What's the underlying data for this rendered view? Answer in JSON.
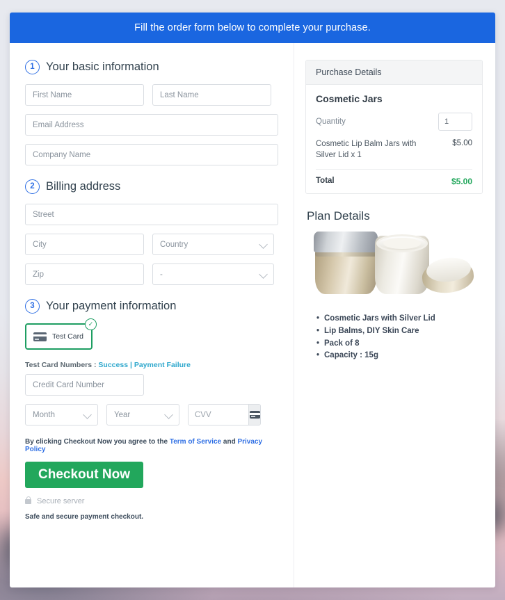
{
  "banner": {
    "text": "Fill the order form below to complete your purchase."
  },
  "basic_info": {
    "step": "1",
    "title": "Your basic information",
    "first_name_placeholder": "First Name",
    "last_name_placeholder": "Last Name",
    "email_placeholder": "Email Address",
    "company_placeholder": "Company Name"
  },
  "billing": {
    "step": "2",
    "title": "Billing address",
    "street_placeholder": "Street",
    "city_placeholder": "City",
    "country_value": "Country",
    "zip_placeholder": "Zip",
    "state_value": "-"
  },
  "payment": {
    "step": "3",
    "title": "Your payment information",
    "card_tile_label": "Test  Card",
    "card_tile_selected_icon": "check-circle-icon",
    "card_icon": "credit-card-icon",
    "test_numbers_label": "Test Card Numbers :",
    "test_numbers_success": "Success",
    "test_numbers_separator": "|",
    "test_numbers_failure": "Payment Failure",
    "credit_card_placeholder": "Credit Card Number",
    "month_value": "Month",
    "year_value": "Year",
    "cvv_placeholder": "CVV",
    "cvv_icon": "credit-card-icon",
    "terms_prefix": "By clicking Checkout Now you agree to the ",
    "terms_link_1": "Term of Service",
    "terms_middle": " and ",
    "terms_link_2": "Privacy Policy",
    "checkout_button": "Checkout Now",
    "secure_icon": "lock-icon",
    "secure_label": "Secure server",
    "safe_note": "Safe and secure payment checkout."
  },
  "purchase": {
    "header": "Purchase Details",
    "product_name": "Cosmetic Jars",
    "quantity_label": "Quantity",
    "quantity_value": "1",
    "line_item_desc": "Cosmetic Lip Balm Jars with Silver Lid x 1",
    "line_item_price": "$5.00",
    "total_label": "Total",
    "total_value": "$5.00"
  },
  "plan": {
    "title": "Plan Details",
    "image_alt": "cosmetic-jars-photo",
    "bullets": [
      "Cosmetic Jars with Silver Lid",
      "Lip Balms, DIY Skin Care",
      "Pack of 8",
      "Capacity : 15g"
    ]
  },
  "colors": {
    "banner_blue": "#1a66e0",
    "accent_blue": "#2f6fe4",
    "green": "#22a75c",
    "link_teal": "#2fa8cd",
    "text_dark": "#3c4858"
  }
}
